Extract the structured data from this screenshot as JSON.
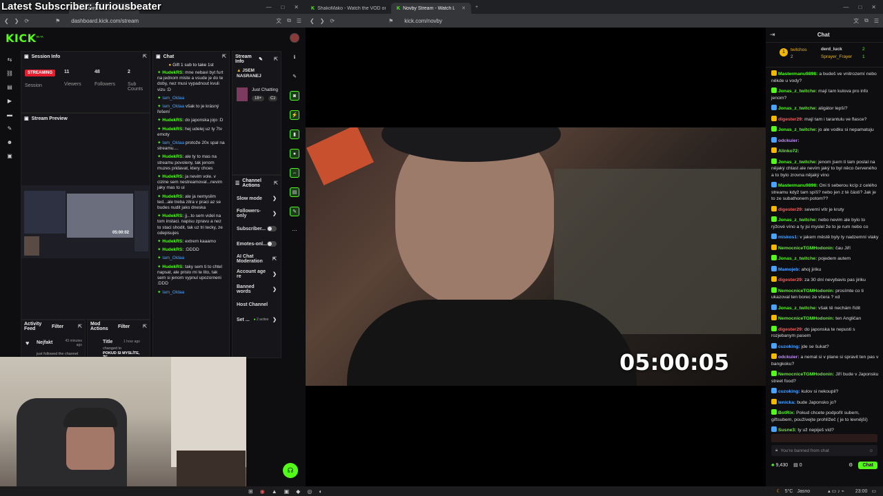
{
  "overlay_title": "Latest Subscriber: furiousbeater",
  "left_window": {
    "tabs": [
      {
        "label": "dashboard.kick.com/stream",
        "active": true
      }
    ],
    "url": "dashboard.kick.com/stream",
    "logo": "KICK",
    "logo_beta": "BETA",
    "session": {
      "title": "Session Info",
      "status": "STREAMING",
      "status_sub": "Session",
      "viewers_value": "11",
      "viewers_label": "Viewers",
      "followers_value": "48",
      "followers_label": "Followers",
      "subs_value": "2",
      "subs_label": "Sub Counts"
    },
    "preview": {
      "title": "Stream Preview",
      "timer": "05:00:02"
    },
    "activity": {
      "title": "Activity Feed",
      "filter": "Filter",
      "user": "Nejfakt",
      "time": "43 minutes ago",
      "text": "just followed the channel"
    },
    "mod": {
      "title": "Mod Actions",
      "filter": "Filter",
      "item_title": "Title",
      "time": "1 hour ago",
      "text": "changed to",
      "highlight": "POKUD SI MYSLÍTE, ŽE"
    },
    "chat": {
      "title": "Chat",
      "pinned": "Gift 1 sub to take 1st",
      "messages": [
        {
          "user": "HudekRS:",
          "cls": "u-g",
          "text": "mne nebavi byt furt na jednom miste a vsude je do te doby, nez musi vypadnout kvuli vizu :D"
        },
        {
          "user": "Iam_Oldaa",
          "cls": "u-b",
          "text": ""
        },
        {
          "user": "Iam_Oldaa",
          "cls": "u-b",
          "text": "však to je krásný řešení"
        },
        {
          "user": "HudekRS:",
          "cls": "u-g",
          "text": "do japonska jojo :D"
        },
        {
          "user": "HudekRS:",
          "cls": "u-g",
          "text": "hej udelej uz ty 7tv emoty"
        },
        {
          "user": "Iam_Oldaa",
          "cls": "u-b",
          "text": "protože 20x spal na streamu...."
        },
        {
          "user": "HudekRS:",
          "cls": "u-g",
          "text": "ale ty to mas na streamu povoleny, tak jenom muzes pridavat, ktery chces"
        },
        {
          "user": "HudekRS:",
          "cls": "u-g",
          "text": "ja nevim vole. v cizine sem nestreamoval...nevim jaky mas to ui"
        },
        {
          "user": "HudekRS:",
          "cls": "u-g",
          "text": "ale ja nemyslim ted...ale treba zitra v praci az se budes nudit jako dneska"
        },
        {
          "user": "HudekRS:",
          "cls": "u-g",
          "text": "jj...to sem videl na tom instaci. napisu zpravu a nez to staci shodit, tak uz tri tecky, ze odepisujes"
        },
        {
          "user": "HudekRS:",
          "cls": "u-g",
          "text": "extrem kaaamo"
        },
        {
          "user": "HudekRS:",
          "cls": "u-g",
          "text": ":DDDD"
        },
        {
          "user": "Iam_Oldaa",
          "cls": "u-b",
          "text": ""
        },
        {
          "user": "HudekRS:",
          "cls": "u-g",
          "text": "taky sem ti to chtel napsat, ale prislo mi te lito, tak sem si jenom vypnul upozorneni :DDD"
        },
        {
          "user": "Iam_Oldaa",
          "cls": "u-b",
          "text": ""
        }
      ]
    },
    "stream_info": {
      "title": "Stream Info",
      "stream_title": "JSEM NASRANEJ",
      "category": "Just Chatting",
      "tag1": "18+",
      "tag2": "Cz"
    },
    "channel_actions": {
      "title": "Channel Actions",
      "items": [
        {
          "label": "Slow mode",
          "kind": "arrow"
        },
        {
          "label": "Followers-only",
          "kind": "arrow"
        },
        {
          "label": "Subscriber...",
          "kind": "toggle"
        },
        {
          "label": "Emotes-onl...",
          "kind": "toggle"
        },
        {
          "label": "AI Chat Moderation",
          "kind": "ext"
        },
        {
          "label": "Account age re",
          "kind": "arrow"
        },
        {
          "label": "Banned words",
          "kind": "arrow"
        },
        {
          "label": "Host Channel",
          "kind": "none"
        }
      ],
      "set_label": "Set ...",
      "active": "2 active"
    }
  },
  "right_window": {
    "tabs": [
      {
        "label": "ShakoMako - Watch the VOD on Kick",
        "active": false
      },
      {
        "label": "Novby Stream - Watch Live o",
        "active": true
      }
    ],
    "url": "kick.com/novby",
    "video_timer": "05:00:05",
    "chat": {
      "title": "Chat",
      "leader1": "twitchos",
      "leader1_count": "2",
      "leader2": "derd_luck",
      "leader2_count": "2",
      "leader3": "Sprayer_Frayer",
      "leader3_count": "1",
      "messages": [
        {
          "user": "Mastermanu9898:",
          "cls": "u-g",
          "text": "a budeš ve vnitrozemí nebo někde u vody?"
        },
        {
          "user": "Jonas_z_twitche:",
          "cls": "u-g",
          "text": "mají tam kulova pro info jenom?"
        },
        {
          "user": "Jonas_z_twitche:",
          "cls": "u-g",
          "text": "aligátor lepší?"
        },
        {
          "user": "digester29:",
          "cls": "u-r",
          "text": "mají tam i tarantulu ve flasce?"
        },
        {
          "user": "Jonas_z_twitche:",
          "cls": "u-g",
          "text": "jo ale vodku si nepamatuju"
        },
        {
          "user": "odckuier:",
          "cls": "u-v",
          "text": ""
        },
        {
          "user": "Alinko72:",
          "cls": "u-g",
          "text": ""
        },
        {
          "user": "Jonas_z_twitche:",
          "cls": "u-g",
          "text": "jenom jsem ti tam poslal na nějaký chlast ale nevím jaký to byl něco červeného a to bylo zrovna nějaký vino"
        },
        {
          "user": "Mastermanu9898:",
          "cls": "u-g",
          "text": "Oni ti seberou kcíp z celého streamu když tam spíš? nebo jen z té části? Jak je to ze subathonem potom??"
        },
        {
          "user": "digester29:",
          "cls": "u-r",
          "text": "severní vítr je kruty"
        },
        {
          "user": "Jonas_z_twitche:",
          "cls": "u-g",
          "text": "nebo nevim ale bylo to rýžové víno a ty jsi myslel že to je rum nebo co"
        },
        {
          "user": "miskos1:",
          "cls": "u-b",
          "text": "v jakem městě byly ty nadzemní vlaky"
        },
        {
          "user": "NemocniceTGMHodonin:",
          "cls": "u-g",
          "text": "čau Jiří"
        },
        {
          "user": "Jonas_z_twitche:",
          "cls": "u-g",
          "text": "pojedem autem"
        },
        {
          "user": "Mamojeb:",
          "cls": "u-b",
          "text": "ahoj jiriku"
        },
        {
          "user": "digester29:",
          "cls": "u-r",
          "text": "za 30 dní nevybavis pas jiriku"
        },
        {
          "user": "NemocniceTGMHodonin:",
          "cls": "u-g",
          "text": "prosímte co ti ukazoval ten borec ze včera ? xd"
        },
        {
          "user": "Jonas_z_twitche:",
          "cls": "u-g",
          "text": "však tě nechám řídit"
        },
        {
          "user": "NemocniceTGMHodonin:",
          "cls": "u-g",
          "text": "ten Angličan"
        },
        {
          "user": "digester29:",
          "cls": "u-r",
          "text": "do japonska te nepusti s rozjebanym pasem"
        },
        {
          "user": "cuzoking:",
          "cls": "u-b",
          "text": "jde se šukat?"
        },
        {
          "user": "odckuier:",
          "cls": "u-v",
          "text": "a nemal si v plane si spravit ten pas v bangkoku?"
        },
        {
          "user": "NemocniceTGMHodonin:",
          "cls": "u-g",
          "text": "Jiří bude v Japonsku street food?"
        },
        {
          "user": "cuzoking:",
          "cls": "u-b",
          "text": "kulov si nekoupil?"
        },
        {
          "user": "lenicka:",
          "cls": "u-b",
          "text": "bude Japonsko jo?"
        },
        {
          "user": "BotRix:",
          "cls": "u-g",
          "text": "Pokud chcete podpořit subem, giftsubem, používejte prohlížeč ( je to levnější)"
        },
        {
          "user": "Susne3:",
          "cls": "u-g",
          "text": "ty už nepiješ víd?"
        }
      ],
      "banned_placeholder": "You're banned from chat",
      "points": "9,430",
      "gift_count": "0",
      "send_label": "Chat"
    }
  },
  "taskbar": {
    "weather": "5°C",
    "weather_desc": "Jasno",
    "clock": "23:00"
  },
  "colors": {
    "kick_green": "#53fc18",
    "streaming_red": "#e51e2f"
  }
}
